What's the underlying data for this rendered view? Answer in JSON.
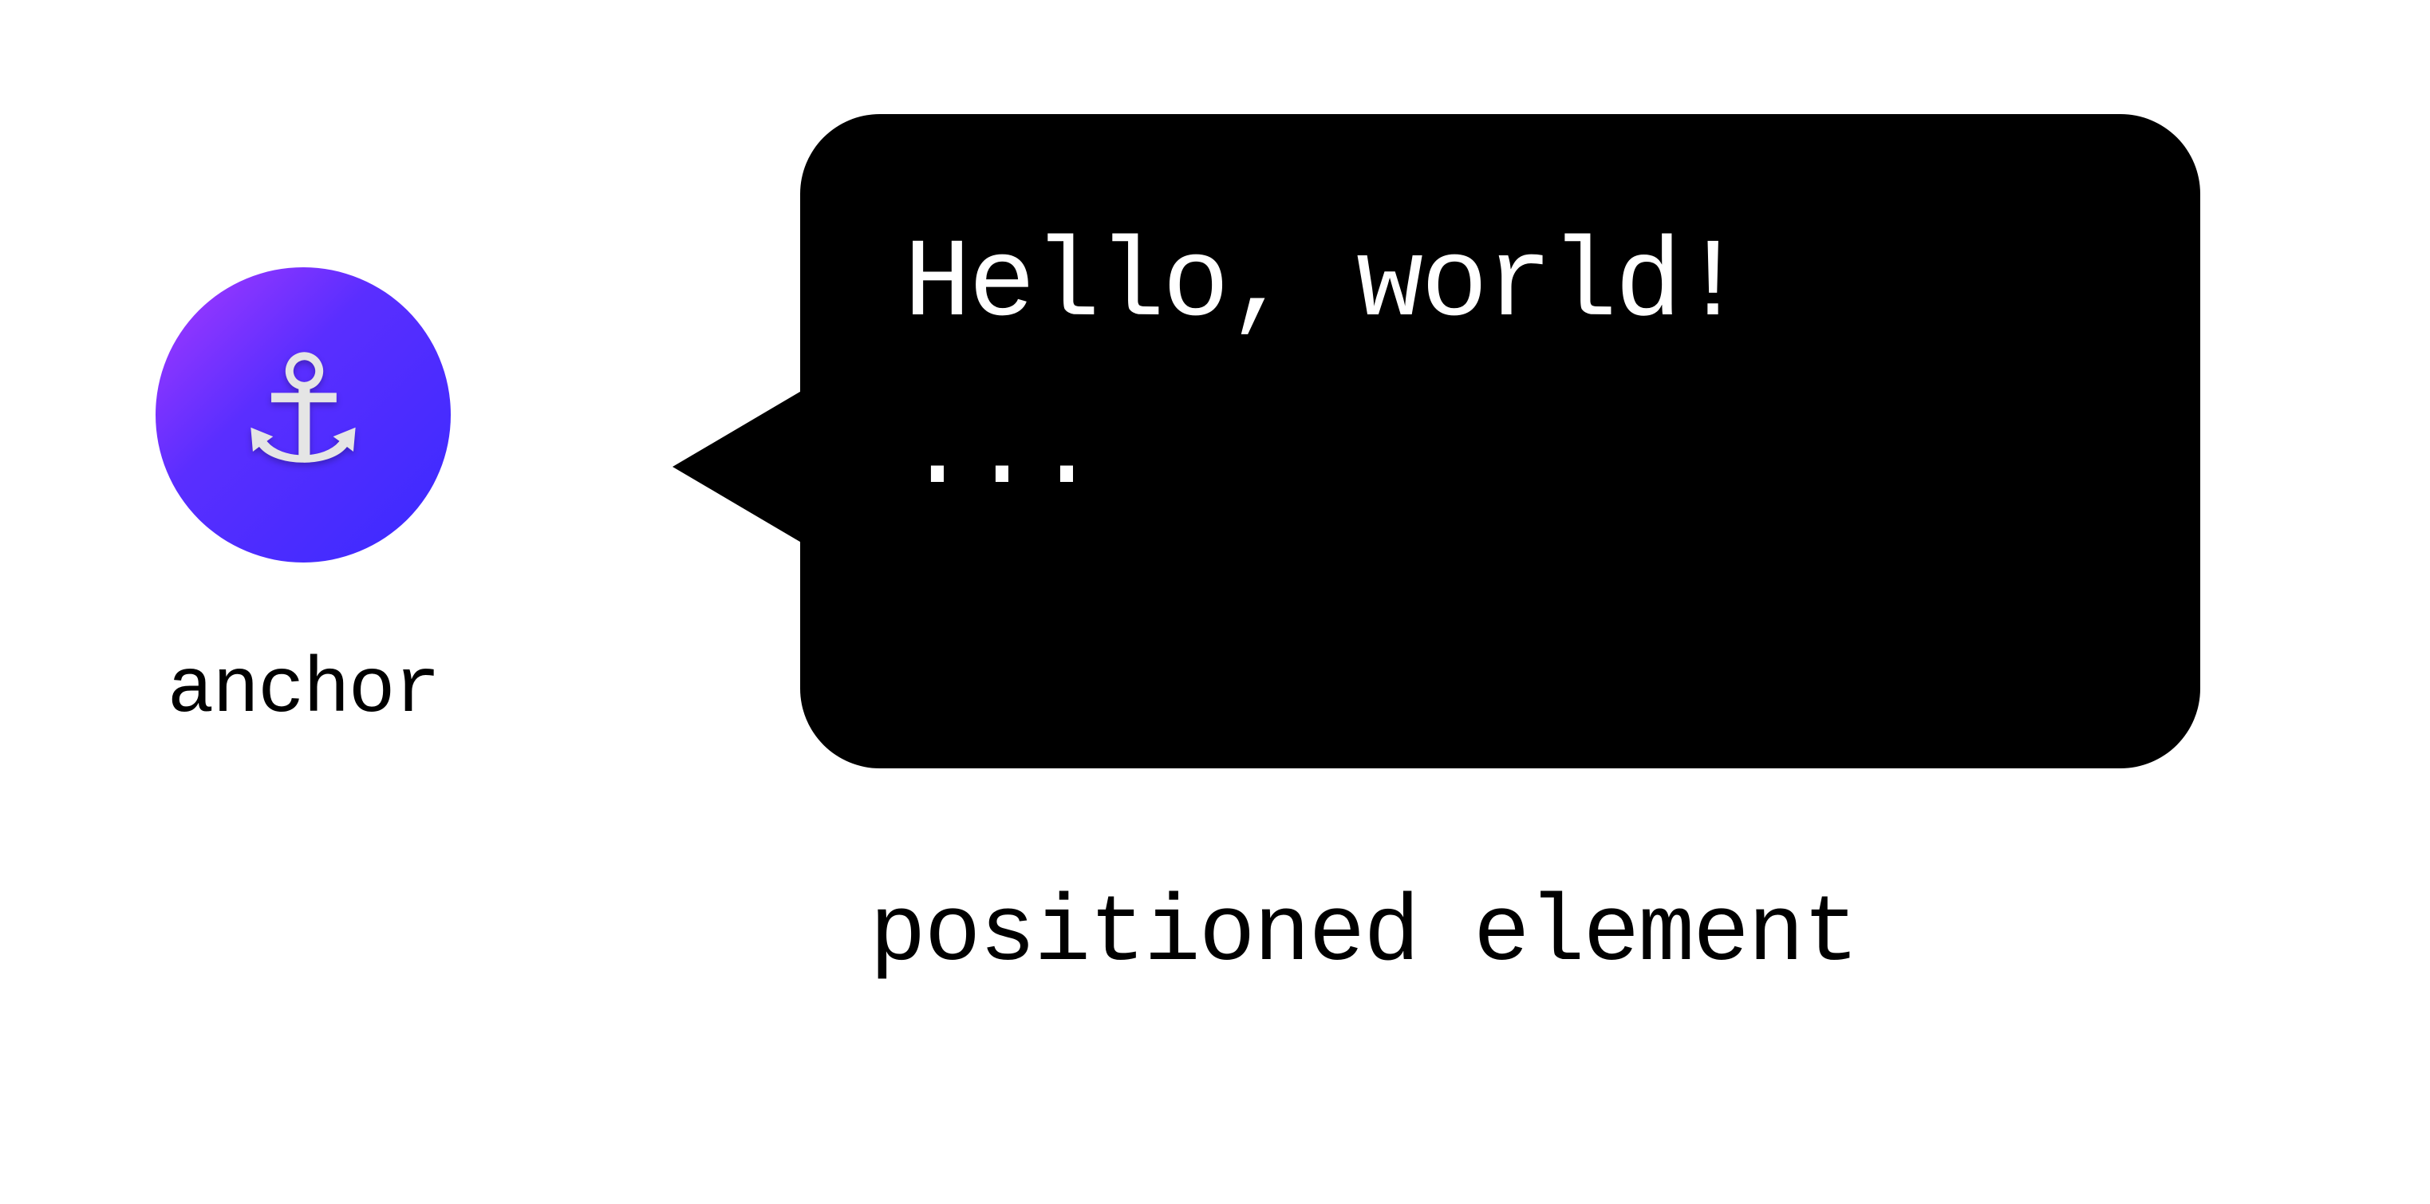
{
  "anchor": {
    "label": "anchor",
    "icon_glyph": "⚓"
  },
  "bubble": {
    "line1": "Hello, world!",
    "line2": "..."
  },
  "positioned_label": "positioned element",
  "colors": {
    "bubble_bg": "#000000",
    "bubble_text": "#ffffff",
    "gradient_start": "#a93aff",
    "gradient_end": "#3a2aff"
  }
}
